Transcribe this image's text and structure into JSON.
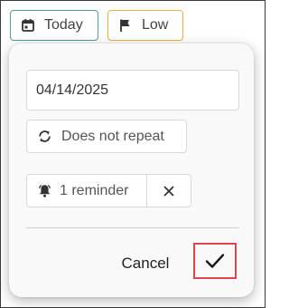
{
  "toolbar": {
    "date_chip": {
      "label": "Today",
      "icon": "calendar-icon",
      "border_color": "#5b9a94"
    },
    "priority_chip": {
      "label": "Low",
      "icon": "flag-icon",
      "border_color": "#e8b23c"
    }
  },
  "popover": {
    "date_value": "04/14/2025",
    "repeat": {
      "label": "Does not repeat",
      "icon": "repeat-icon"
    },
    "reminder": {
      "label": "1 reminder",
      "icon": "bell-icon",
      "clear_icon": "close-icon"
    },
    "actions": {
      "cancel_label": "Cancel",
      "confirm_icon": "check-icon",
      "highlight_color": "#e0474a"
    }
  }
}
